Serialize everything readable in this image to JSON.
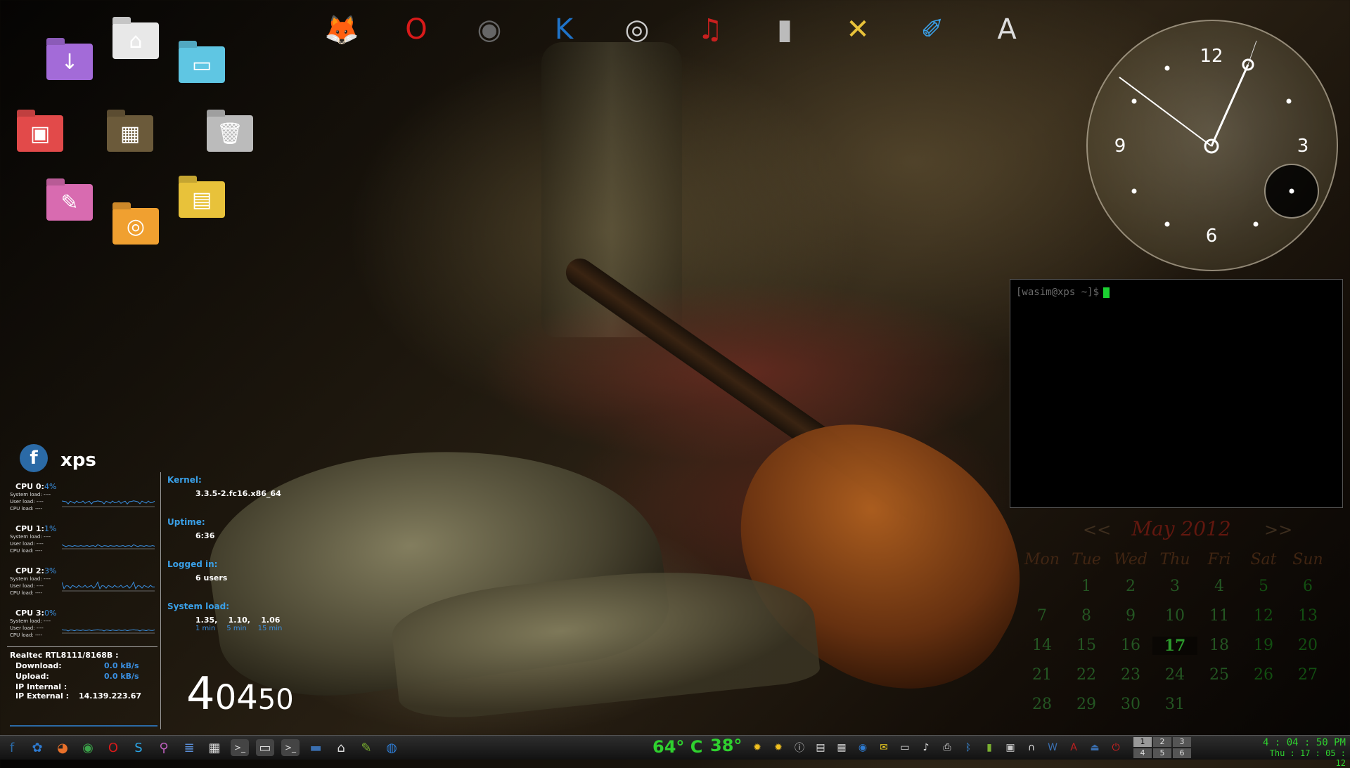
{
  "colors": {
    "accent_blue": "#3a8fe0",
    "accent_green": "#2fd12f",
    "terminal_bg": "#000000",
    "cursor": "#1bd131"
  },
  "desktop_icons": [
    {
      "name": "downloads-folder-icon",
      "glyph": "↓",
      "color": "#a36bd8"
    },
    {
      "name": "home-icon",
      "glyph": "⌂",
      "color": "#e8e8e8"
    },
    {
      "name": "documents-folder-icon",
      "glyph": "▭",
      "color": "#5fc6e3"
    },
    {
      "name": "pictures-folder-icon",
      "glyph": "▣",
      "color": "#e24a4a"
    },
    {
      "name": "wallpaper-preview-icon",
      "glyph": "▦",
      "color": "#6b5a3a"
    },
    {
      "name": "trash-icon",
      "glyph": "🗑",
      "color": "#bbbbbb"
    },
    {
      "name": "text-folder-icon",
      "glyph": "✎",
      "color": "#d86bb0"
    },
    {
      "name": "cd-folder-icon",
      "glyph": "◎",
      "color": "#f0a030"
    },
    {
      "name": "videos-folder-icon",
      "glyph": "▤",
      "color": "#e8c23a"
    }
  ],
  "dock_icons": [
    {
      "name": "firefox-icon",
      "glyph": "🦊",
      "color": "#e8702a"
    },
    {
      "name": "opera-icon",
      "glyph": "O",
      "color": "#d91a1a"
    },
    {
      "name": "chrome-icon",
      "glyph": "◉",
      "color": "#666666"
    },
    {
      "name": "kde-icon",
      "glyph": "K",
      "color": "#1f73c9"
    },
    {
      "name": "webcam-icon",
      "glyph": "◎",
      "color": "#cccccc"
    },
    {
      "name": "guitar-icon",
      "glyph": "♫",
      "color": "#c9201f"
    },
    {
      "name": "usb-drive-icon",
      "glyph": "▮",
      "color": "#bbbbbb"
    },
    {
      "name": "tools-icon",
      "glyph": "✕",
      "color": "#e8c23a"
    },
    {
      "name": "paint-icon",
      "glyph": "✐",
      "color": "#3aa0e8"
    },
    {
      "name": "text-editor-icon",
      "glyph": "A",
      "color": "#dddddd"
    }
  ],
  "clock": {
    "numbers": [
      "12",
      "3",
      "6",
      "9"
    ]
  },
  "terminal": {
    "prompt": "[wasim@xps ~]$"
  },
  "calendar": {
    "nav_prev": "<<",
    "month_year": "May 2012",
    "nav_next": ">>",
    "weekdays": [
      "Mon",
      "Tue",
      "Wed",
      "Thu",
      "Fri",
      "Sat",
      "Sun"
    ],
    "weeks": [
      [
        "",
        "1",
        "2",
        "3",
        "4",
        "5",
        "6"
      ],
      [
        "7",
        "8",
        "9",
        "10",
        "11",
        "12",
        "13"
      ],
      [
        "14",
        "15",
        "16",
        "17",
        "18",
        "19",
        "20"
      ],
      [
        "21",
        "22",
        "23",
        "24",
        "25",
        "26",
        "27"
      ],
      [
        "28",
        "29",
        "30",
        "31",
        "",
        "",
        ""
      ]
    ],
    "today": "17"
  },
  "sysmon": {
    "fedora_glyph": "f",
    "hostname": "xps",
    "cpus": [
      {
        "label": "CPU 0:",
        "value": "4%"
      },
      {
        "label": "CPU 1:",
        "value": "1%"
      },
      {
        "label": "CPU 2:",
        "value": "3%"
      },
      {
        "label": "CPU 3:",
        "value": "0%"
      }
    ],
    "cpu_sub_labels": [
      "System load:",
      "User load:",
      "CPU load:"
    ],
    "cpu_sub_value": "----",
    "kernel_label": "Kernel:",
    "kernel": "3.3.5-2.fc16.x86_64",
    "uptime_label": "Uptime:",
    "uptime": "6:36",
    "logged_label": "Logged in:",
    "logged": "6 users",
    "load_label": "System load:",
    "load_values": "1.35,    1.10,    1.06",
    "load_periods": "1 min     5 min     15 min",
    "net_adapter": "Realtec RTL8111/8168B :",
    "download_label": "Download:",
    "download": "0.0 kB/s",
    "upload_label": "Upload:",
    "upload": "0.0 kB/s",
    "ip_internal_label": "IP Internal :",
    "ip_external_label": "IP External :",
    "ip_external": "14.139.223.67",
    "time_hour": "4",
    "time_min": "04",
    "time_sec": "50"
  },
  "taskbar": {
    "launchers": [
      {
        "name": "fedora-menu-icon",
        "glyph": "f",
        "color": "#2b6aa6"
      },
      {
        "name": "kde-launcher-icon",
        "glyph": "✿",
        "color": "#2e7bd1"
      },
      {
        "name": "firefox-task-icon",
        "glyph": "◕",
        "color": "#e8702a"
      },
      {
        "name": "chrome-task-icon",
        "glyph": "◉",
        "color": "#3ba34a"
      },
      {
        "name": "opera-task-icon",
        "glyph": "O",
        "color": "#d91a1a"
      },
      {
        "name": "skype-task-icon",
        "glyph": "S",
        "color": "#2aa6e8"
      },
      {
        "name": "scanner-task-icon",
        "glyph": "⚲",
        "color": "#c060c0"
      },
      {
        "name": "writer-task-icon",
        "glyph": "≣",
        "color": "#5a8fd8"
      },
      {
        "name": "calc-task-icon",
        "glyph": "▦",
        "color": "#dddddd"
      },
      {
        "name": "terminal-task-icon-1",
        "glyph": ">_",
        "color": "#444444"
      },
      {
        "name": "terminal-task-icon-2",
        "glyph": "▭",
        "color": "#444444"
      },
      {
        "name": "terminal-task-icon-3",
        "glyph": ">_",
        "color": "#444444"
      },
      {
        "name": "desktop-task-icon",
        "glyph": "▬",
        "color": "#3a6fb0"
      },
      {
        "name": "home-task-icon",
        "glyph": "⌂",
        "color": "#dddddd"
      },
      {
        "name": "editor-task-icon",
        "glyph": "✎",
        "color": "#7ab030"
      },
      {
        "name": "network-task-icon",
        "glyph": "◍",
        "color": "#2e7bd1"
      }
    ],
    "cpu_temp": "64° C",
    "gpu_temp": "38°",
    "tray": [
      {
        "name": "weather-icon-1",
        "glyph": "✹",
        "color": "#f0c020"
      },
      {
        "name": "weather-icon-2",
        "glyph": "✹",
        "color": "#f0c020"
      },
      {
        "name": "info-icon",
        "glyph": "ⓘ",
        "color": "#cccccc"
      },
      {
        "name": "clipboard-icon",
        "glyph": "▤",
        "color": "#dddddd"
      },
      {
        "name": "display-icon",
        "glyph": "▦",
        "color": "#cccccc"
      },
      {
        "name": "globe-icon",
        "glyph": "◉",
        "color": "#2e7bd1"
      },
      {
        "name": "notes-icon",
        "glyph": "✉",
        "color": "#f0d020"
      },
      {
        "name": "files-icon",
        "glyph": "▭",
        "color": "#dddddd"
      },
      {
        "name": "volume-icon",
        "glyph": "♪",
        "color": "#dddddd"
      },
      {
        "name": "printer-icon",
        "glyph": "⎙",
        "color": "#dddddd"
      },
      {
        "name": "bluetooth-icon",
        "glyph": "ᛒ",
        "color": "#3a8fe0"
      },
      {
        "name": "battery-icon",
        "glyph": "▮",
        "color": "#7ab030"
      },
      {
        "name": "network-tray-icon",
        "glyph": "▣",
        "color": "#cccccc"
      },
      {
        "name": "headphones-icon",
        "glyph": "∩",
        "color": "#dddddd"
      },
      {
        "name": "wallet-icon",
        "glyph": "W",
        "color": "#3a6fb0"
      },
      {
        "name": "spellcheck-icon",
        "glyph": "A",
        "color": "#c02020"
      },
      {
        "name": "removable-media-icon",
        "glyph": "⏏",
        "color": "#3a6fb0"
      },
      {
        "name": "power-icon",
        "glyph": "⏻",
        "color": "#d02020"
      }
    ],
    "pager": [
      "1",
      "2",
      "3",
      "4",
      "5",
      "6"
    ],
    "active_desktop": "1",
    "time": "4 : 04 : 50 PM",
    "date": "Thu : 17 : 05 : 12"
  }
}
